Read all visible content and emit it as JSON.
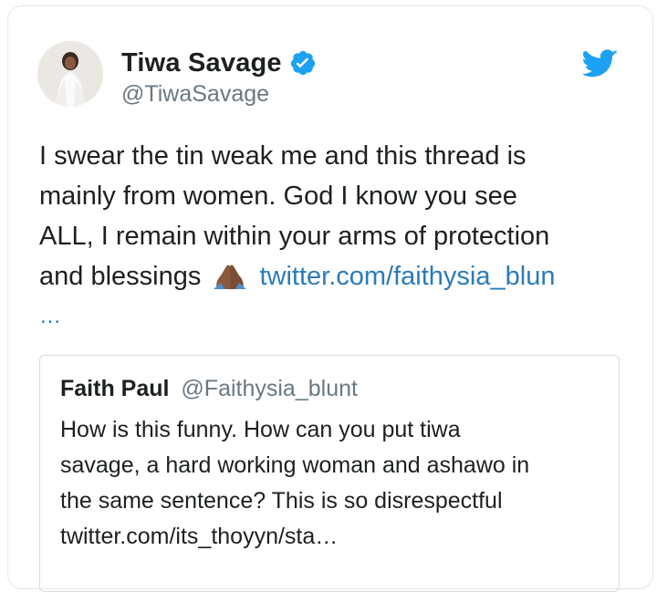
{
  "author": {
    "display_name": "Tiwa Savage",
    "handle": "@TiwaSavage",
    "verified": true
  },
  "brand": {
    "icon": "twitter-bird-icon",
    "color": "#1da1f2"
  },
  "tweet": {
    "lines": [
      "I swear the tin weak me and this thread is",
      "mainly from women. God I know you see",
      "ALL, I remain within your arms of protection",
      "and blessings"
    ],
    "emoji": "folded-hands-emoji",
    "link_text": "twitter.com/faithysia_blun",
    "ellipsis": "…"
  },
  "quoted_tweet": {
    "display_name": "Faith Paul",
    "handle": "@Faithysia_blunt",
    "lines": [
      "How is this funny. How can you put tiwa",
      "savage, a hard working woman and ashawo in",
      "the same sentence? This is so disrespectful",
      "twitter.com/its_thoyyn/sta…"
    ]
  },
  "colors": {
    "text": "#1c2022",
    "secondary": "#697882",
    "link": "#2b7bb9",
    "border": "#e1e8ed"
  }
}
